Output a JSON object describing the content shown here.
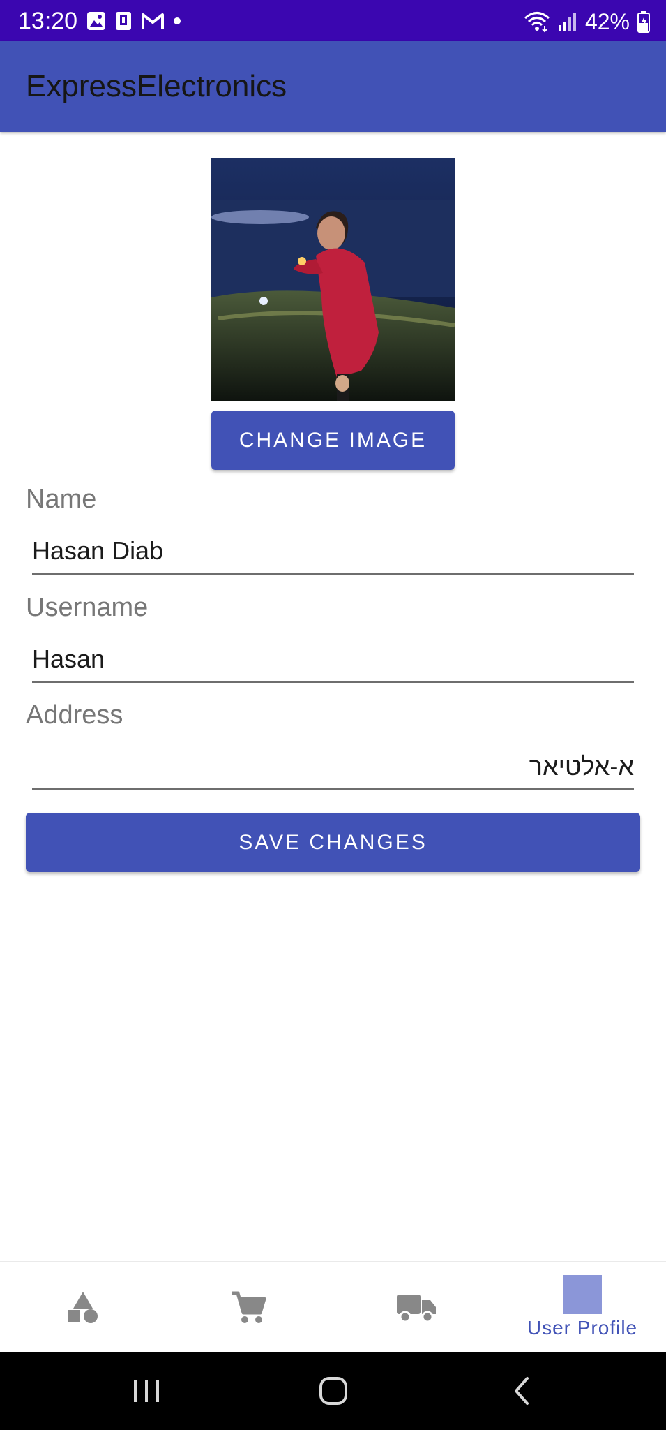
{
  "status_bar": {
    "time": "13:20",
    "battery": "42%",
    "left_icons": [
      "image-icon",
      "sim-icon",
      "gmail-icon",
      "dot-icon"
    ],
    "right_icons": [
      "wifi-icon",
      "signal-icon",
      "battery-icon"
    ]
  },
  "app_bar": {
    "title": "ExpressElectronics"
  },
  "profile": {
    "photo_alt": "profile-photo",
    "change_image_label": "CHANGE IMAGE"
  },
  "form": {
    "name_label": "Name",
    "name_value": "Hasan Diab",
    "username_label": "Username",
    "username_value": "Hasan",
    "address_label": "Address",
    "address_value": "א-אלטיאר"
  },
  "save_label": "SAVE CHANGES",
  "bottom_nav": {
    "items": [
      {
        "icon": "categories-icon",
        "label": ""
      },
      {
        "icon": "cart-icon",
        "label": ""
      },
      {
        "icon": "delivery-truck-icon",
        "label": ""
      },
      {
        "icon": "user-profile-avatar",
        "label": "User Profile"
      }
    ],
    "active_color": "#4152b6"
  },
  "system_nav": {
    "buttons": [
      "recents-icon",
      "home-icon",
      "back-icon"
    ]
  },
  "colors": {
    "status_bar": "#3b06b0",
    "primary": "#4152b6",
    "nav_bar": "#000000"
  }
}
